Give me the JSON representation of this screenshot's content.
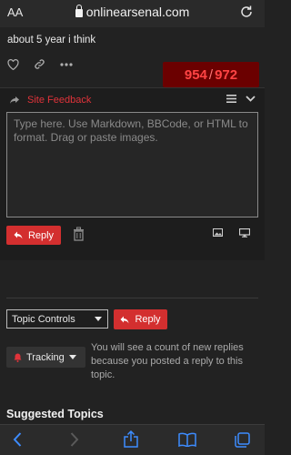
{
  "browser": {
    "reader_label": "AA",
    "url": "onlinearsenal.com"
  },
  "post": {
    "text": "about 5 year i think",
    "counter_current": "954",
    "counter_separator": "/",
    "counter_total": "972"
  },
  "composer": {
    "category": "Site Feedback",
    "placeholder": "Type here. Use Markdown, BBCode, or HTML to format. Drag or paste images.",
    "reply_label": "Reply"
  },
  "topic_controls": {
    "select_label": "Topic Controls",
    "reply_label": "Reply",
    "tracking_label": "Tracking",
    "tracking_description": "You will see a count of new replies because you posted a reply to this topic."
  },
  "suggested": {
    "heading": "Suggested Topics"
  },
  "colors": {
    "accent": "#d32f2f",
    "counter_bg": "#6b0000",
    "counter_text": "#ff4444",
    "background": "#222222"
  }
}
